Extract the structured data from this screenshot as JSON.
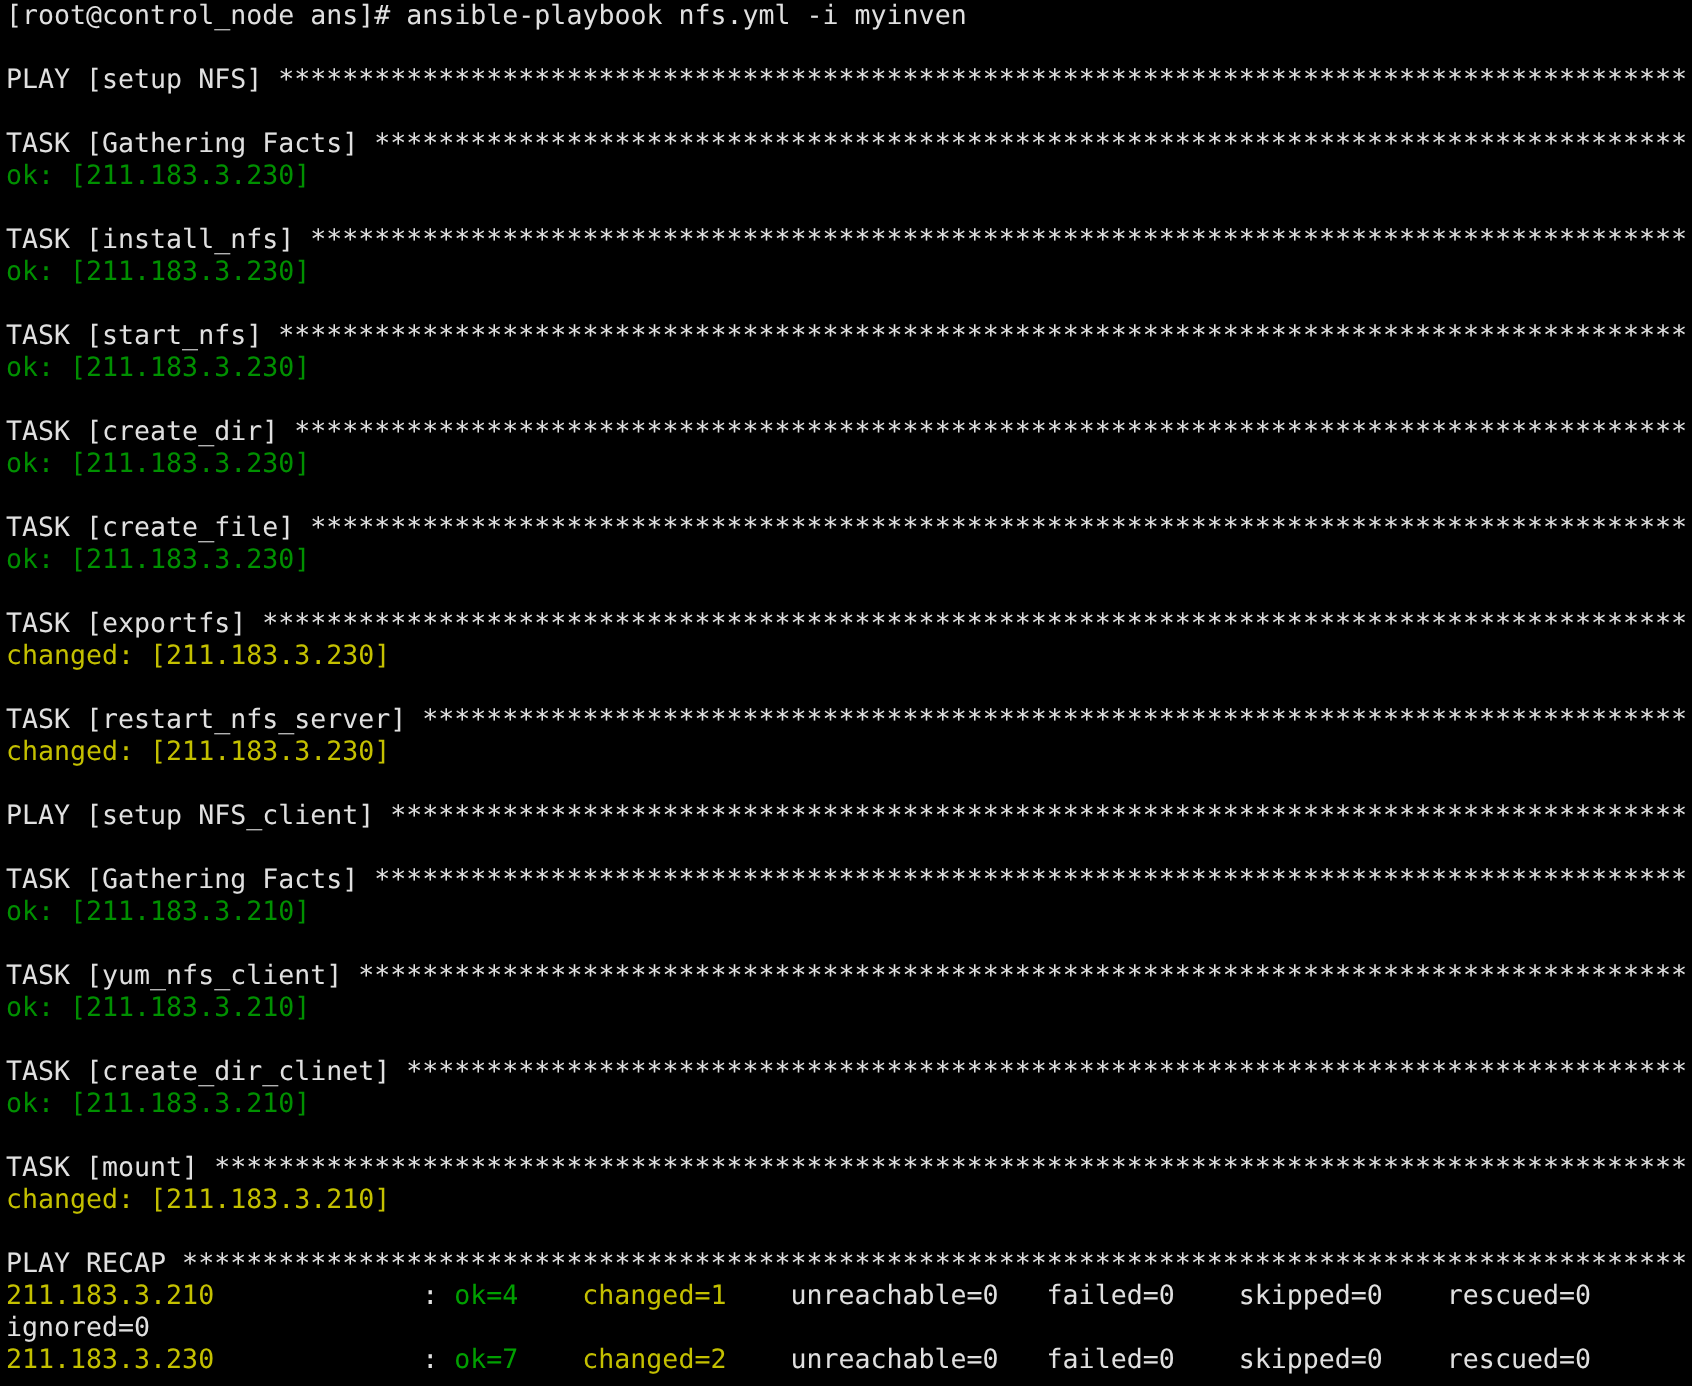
{
  "prompt": "[root@control_node ans]# ansible-playbook nfs.yml -i myinven",
  "plays": [
    {
      "header": "PLAY [setup NFS] ****************************************************************************************",
      "tasks": [
        {
          "header": "TASK [Gathering Facts] **********************************************************************************",
          "result": {
            "kind": "ok",
            "text": "ok: [211.183.3.230]"
          }
        },
        {
          "header": "TASK [install_nfs] **************************************************************************************",
          "result": {
            "kind": "ok",
            "text": "ok: [211.183.3.230]"
          }
        },
        {
          "header": "TASK [start_nfs] ****************************************************************************************",
          "result": {
            "kind": "ok",
            "text": "ok: [211.183.3.230]"
          }
        },
        {
          "header": "TASK [create_dir] ***************************************************************************************",
          "result": {
            "kind": "ok",
            "text": "ok: [211.183.3.230]"
          }
        },
        {
          "header": "TASK [create_file] **************************************************************************************",
          "result": {
            "kind": "ok",
            "text": "ok: [211.183.3.230]"
          }
        },
        {
          "header": "TASK [exportfs] *****************************************************************************************",
          "result": {
            "kind": "changed",
            "text": "changed: [211.183.3.230]"
          }
        },
        {
          "header": "TASK [restart_nfs_server] *******************************************************************************",
          "result": {
            "kind": "changed",
            "text": "changed: [211.183.3.230]"
          }
        }
      ]
    },
    {
      "header": "PLAY [setup NFS_client] *********************************************************************************",
      "tasks": [
        {
          "header": "TASK [Gathering Facts] **********************************************************************************",
          "result": {
            "kind": "ok",
            "text": "ok: [211.183.3.210]"
          }
        },
        {
          "header": "TASK [yum_nfs_client] ***********************************************************************************",
          "result": {
            "kind": "ok",
            "text": "ok: [211.183.3.210]"
          }
        },
        {
          "header": "TASK [create_dir_clinet] ********************************************************************************",
          "result": {
            "kind": "ok",
            "text": "ok: [211.183.3.210]"
          }
        },
        {
          "header": "TASK [mount] ********************************************************************************************",
          "result": {
            "kind": "changed",
            "text": "changed: [211.183.3.210]"
          }
        }
      ]
    }
  ],
  "recap": {
    "header": "PLAY RECAP **********************************************************************************************",
    "hosts": [
      {
        "host": "211.183.3.210",
        "color": "#c4c000",
        "separator": ":",
        "stats": [
          {
            "kind": "ok",
            "text": "ok=4",
            "color": "#00a000"
          },
          {
            "kind": "changed",
            "text": "changed=1",
            "color": "#c4c000"
          },
          {
            "kind": "unreachable",
            "text": "unreachable=0",
            "color": "#e0e0e0"
          },
          {
            "kind": "failed",
            "text": "failed=0",
            "color": "#e0e0e0"
          },
          {
            "kind": "skipped",
            "text": "skipped=0",
            "color": "#e0e0e0"
          },
          {
            "kind": "rescued",
            "text": "rescued=0",
            "color": "#e0e0e0"
          },
          {
            "kind": "ignored",
            "text": "ignored=0",
            "color": "#e0e0e0"
          }
        ]
      },
      {
        "host": "211.183.3.230",
        "color": "#c4c000",
        "separator": ":",
        "stats": [
          {
            "kind": "ok",
            "text": "ok=7",
            "color": "#00a000"
          },
          {
            "kind": "changed",
            "text": "changed=2",
            "color": "#c4c000"
          },
          {
            "kind": "unreachable",
            "text": "unreachable=0",
            "color": "#e0e0e0"
          },
          {
            "kind": "failed",
            "text": "failed=0",
            "color": "#e0e0e0"
          },
          {
            "kind": "skipped",
            "text": "skipped=0",
            "color": "#e0e0e0"
          },
          {
            "kind": "rescued",
            "text": "rescued=0",
            "color": "#e0e0e0"
          }
        ]
      }
    ]
  }
}
